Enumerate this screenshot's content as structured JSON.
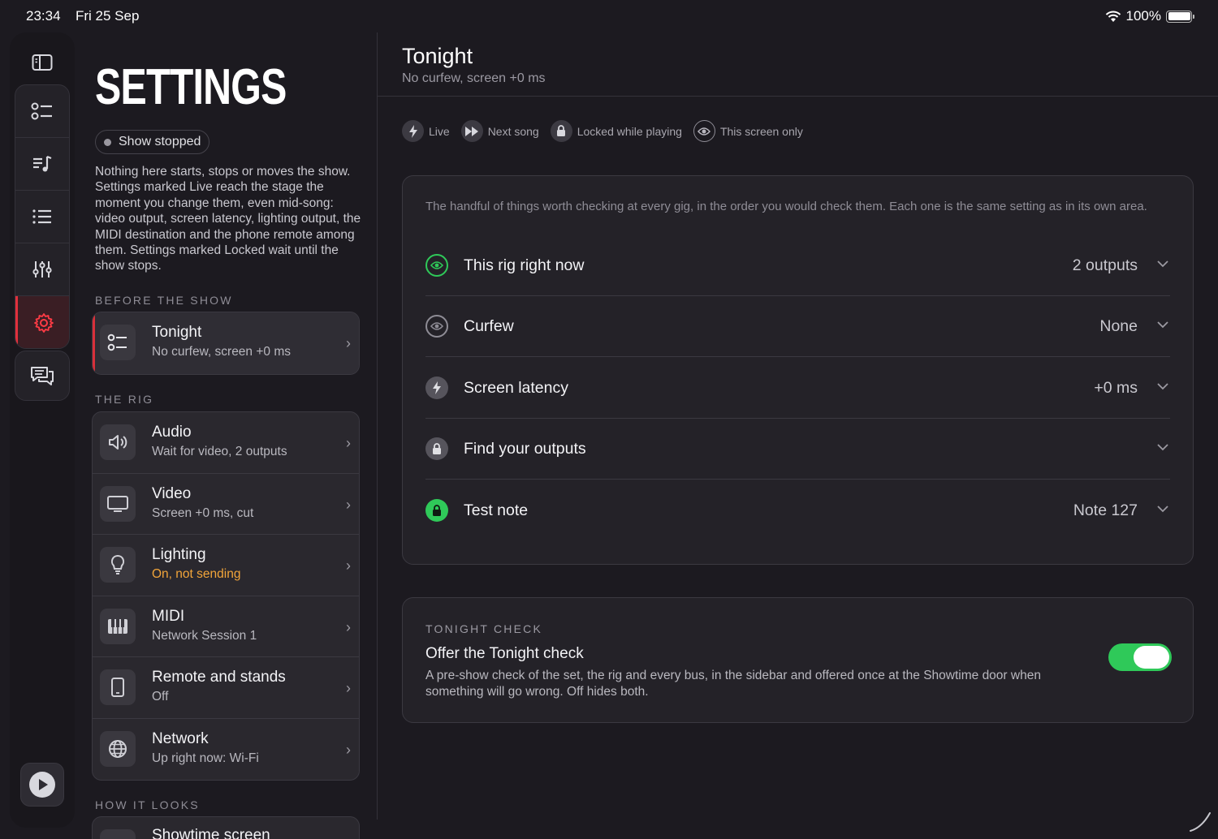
{
  "status_bar": {
    "time": "23:34",
    "date": "Fri 25 Sep",
    "battery": "100%"
  },
  "rail": {
    "items": [
      {
        "icon": "sidebar-toggle-icon"
      },
      {
        "icon": "checklist-icon"
      },
      {
        "icon": "music-list-icon"
      },
      {
        "icon": "list-icon"
      },
      {
        "icon": "sliders-icon"
      },
      {
        "icon": "gear-icon",
        "active": true
      },
      {
        "icon": "chat-bubbles-icon"
      },
      {
        "icon": "play-icon"
      }
    ]
  },
  "sidebar": {
    "title": "SETTINGS",
    "status": "Show stopped",
    "intro": "Nothing here starts, stops or moves the show. Settings marked Live reach the stage the moment you change them, even mid-song: video output, screen latency, lighting output, the MIDI destination and the phone remote among them. Settings marked Locked wait until the show stops.",
    "sections": [
      {
        "label": "BEFORE THE SHOW",
        "items": [
          {
            "title": "Tonight",
            "subtitle": "No curfew, screen +0 ms",
            "icon": "checklist-icon"
          }
        ]
      },
      {
        "label": "THE RIG",
        "items": [
          {
            "title": "Audio",
            "subtitle": "Wait for video, 2 outputs",
            "icon": "speaker-icon"
          },
          {
            "title": "Video",
            "subtitle": "Screen +0 ms, cut",
            "icon": "monitor-icon"
          },
          {
            "title": "Lighting",
            "subtitle": "On, not sending",
            "icon": "lightbulb-icon"
          },
          {
            "title": "MIDI",
            "subtitle": "Network Session 1",
            "icon": "piano-keys-icon"
          },
          {
            "title": "Remote and stands",
            "subtitle": "Off",
            "icon": "phone-icon"
          },
          {
            "title": "Network",
            "subtitle": "Up right now: Wi-Fi",
            "icon": "globe-icon"
          }
        ]
      },
      {
        "label": "HOW IT LOOKS",
        "items": [
          {
            "title": "Showtime screen",
            "subtitle": "",
            "icon": "screen-icon"
          }
        ]
      }
    ]
  },
  "main": {
    "title": "Tonight",
    "subtitle": "No curfew, screen +0 ms",
    "legend": [
      {
        "label": "Live",
        "icon": "bolt-icon"
      },
      {
        "label": "Next song",
        "icon": "fast-forward-icon"
      },
      {
        "label": "Locked while playing",
        "icon": "lock-icon"
      },
      {
        "label": "This screen only",
        "icon": "eye-icon"
      }
    ],
    "panel_desc": "The handful of things worth checking at every gig, in the order you would check them. Each one is the same setting as in its own area.",
    "settings": [
      {
        "label": "This rig right now",
        "value": "2 outputs",
        "icon": "eye-icon",
        "color": "#2fc959"
      },
      {
        "label": "Curfew",
        "value": "None",
        "icon": "eye-icon",
        "color": "#8e8c95"
      },
      {
        "label": "Screen latency",
        "value": "+0 ms",
        "icon": "bolt-icon",
        "color": "#8e8c95"
      },
      {
        "label": "Find your outputs",
        "value": "",
        "icon": "lock-icon",
        "color": "#8e8c95"
      },
      {
        "label": "Test note",
        "value": "Note 127",
        "icon": "lock-icon",
        "color": "#2fc959"
      }
    ],
    "check": {
      "label": "TONIGHT CHECK",
      "title": "Offer the Tonight check",
      "desc": "A pre-show check of the set, the rig and every bus, in the sidebar and offered once at the Showtime door when something will go wrong. Off hides both.",
      "enabled": true
    }
  }
}
